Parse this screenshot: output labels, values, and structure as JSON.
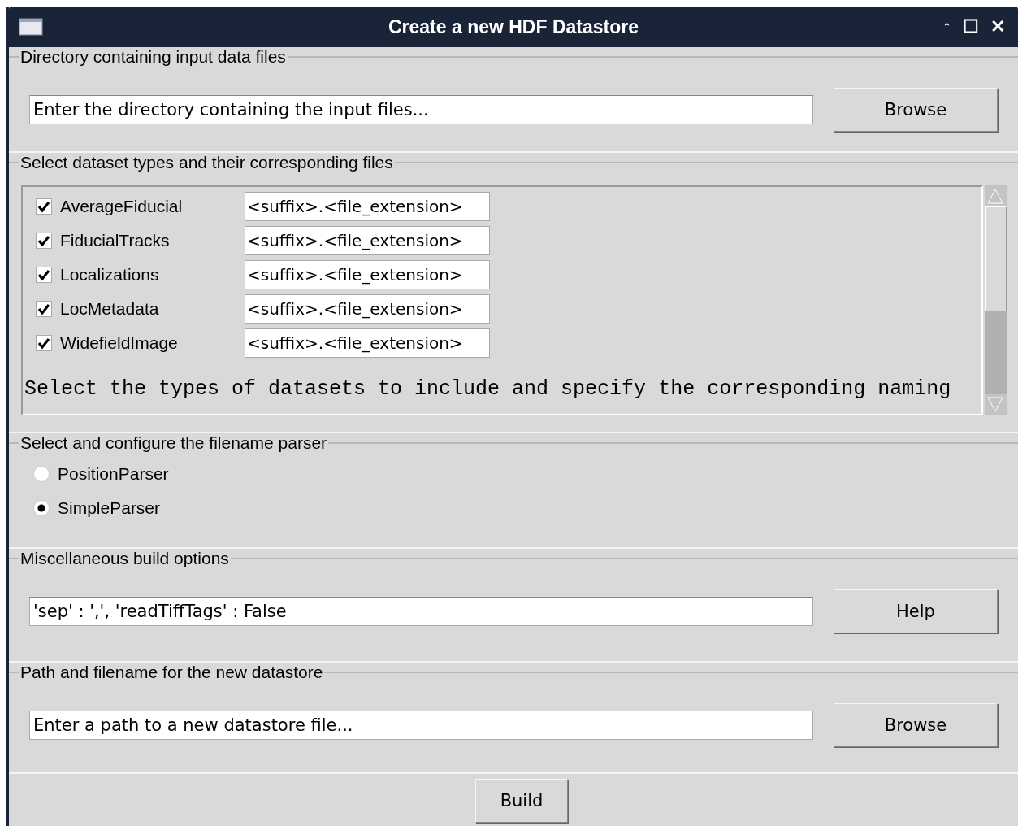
{
  "window": {
    "title": "Create a new HDF Datastore",
    "controls": [
      "↑",
      "☐",
      "✕"
    ]
  },
  "directory": {
    "legend": "Directory containing input data files",
    "value": "Enter the directory containing the input files...",
    "button": "Browse"
  },
  "datasets": {
    "legend": "Select dataset types and their corresponding files",
    "items": [
      {
        "label": "AverageFiducial",
        "checked": true,
        "value": "<suffix>.<file_extension>"
      },
      {
        "label": "FiducialTracks",
        "checked": true,
        "value": "<suffix>.<file_extension>"
      },
      {
        "label": "Localizations",
        "checked": true,
        "value": "<suffix>.<file_extension>"
      },
      {
        "label": "LocMetadata",
        "checked": true,
        "value": "<suffix>.<file_extension>"
      },
      {
        "label": "WidefieldImage",
        "checked": true,
        "value": "<suffix>.<file_extension>"
      }
    ],
    "help": "Select the types of datasets to include and specify the corresponding naming"
  },
  "parser": {
    "legend": "Select and configure the filename parser",
    "options": [
      {
        "label": "PositionParser",
        "selected": false
      },
      {
        "label": "SimpleParser",
        "selected": true
      }
    ]
  },
  "misc": {
    "legend": "Miscellaneous build options",
    "value": "'sep' : ',', 'readTiffTags' : False",
    "button": "Help"
  },
  "output": {
    "legend": "Path and filename for the new datastore",
    "value": "Enter a path to a new datastore file...",
    "button": "Browse"
  },
  "build_button": "Build"
}
